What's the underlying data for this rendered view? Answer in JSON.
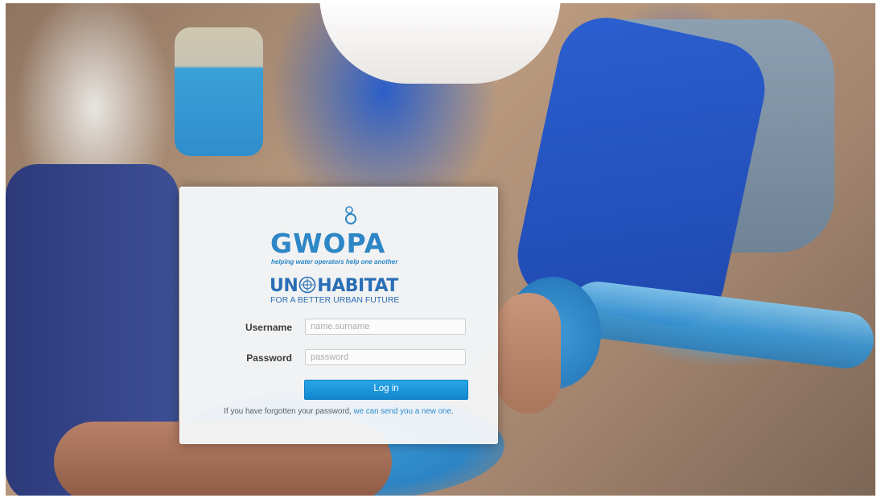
{
  "brand": {
    "gwopa_name": "GWOPA",
    "gwopa_tagline": "helping water operators help one another",
    "un_left": "UN",
    "un_right": "HABITAT",
    "un_tagline": "FOR A BETTER URBAN FUTURE",
    "brand_color": "#2d86c6"
  },
  "form": {
    "username_label": "Username",
    "username_placeholder": "name.surname",
    "username_value": "",
    "password_label": "Password",
    "password_placeholder": "password",
    "password_value": "",
    "login_label": "Log in",
    "login_color": "#1a96dc"
  },
  "recovery": {
    "prefix": "If you have forgotten your password,",
    "link_text": "we can send you a new one",
    "suffix": "."
  }
}
